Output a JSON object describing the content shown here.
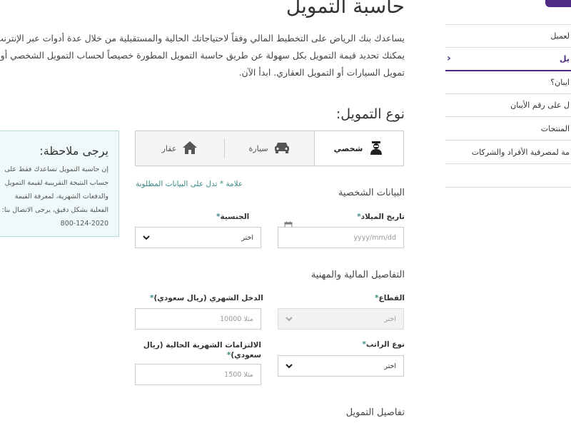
{
  "page": {
    "title": "حاسبة التمويل",
    "intro": "يساعدك بنك الرياض على التخطيط المالي وفقاً لاحتياجاتك الحالية والمستقبلية من خلال عدة أدوات عبر الإنترنت. يمكنك تحديد قيمة التمويل بكل سهولة عن طريق حاسبة التمويل المطورة خصيصاً لحساب التمويل الشخصي أو تمويل السيارات أو التمويل العقاري. ابدأ الآن."
  },
  "sidebar": {
    "items": [
      {
        "label": "لعميل"
      },
      {
        "label": "يل"
      },
      {
        "label": "ايبان؟"
      },
      {
        "label": "ل على رقم الأيبان"
      },
      {
        "label": "المنتجات"
      },
      {
        "label": "مة لمصرفية الأفراد والشركات"
      }
    ],
    "accent": "#4c2a85"
  },
  "financing": {
    "heading": "نوع التمويل:",
    "tabs": [
      {
        "label": "شخصي",
        "icon": "person-icon",
        "selected": true
      },
      {
        "label": "سيارة",
        "icon": "car-icon",
        "selected": false
      },
      {
        "label": "عقار",
        "icon": "home-icon",
        "selected": false
      }
    ],
    "required_note": "علامة * تدل على البيانات المطلوبة"
  },
  "note": {
    "title": "يرجى ملاحظة:",
    "body": "إن حاسبة التمويل تساعدك فقط على حساب النتيجة التقريبية لقيمة التمويل والدفعات الشهرية، لمعرفة القيمة الفعلية بشكل دقيق، يرجى الاتصال بنا: 2020-124-800"
  },
  "personal": {
    "heading": "البيانات الشخصية",
    "birth_label": "تاريخ الميلاد",
    "birth_placeholder": "yyyy/mm/dd",
    "nationality_label": "الجنسية",
    "nationality_value": "اختر"
  },
  "financial": {
    "heading": "التفاصيل المالية والمهنية",
    "sector_label": "القطاع",
    "sector_value": "اختر",
    "income_label": "الدخل الشهري (ريال سعودي)",
    "income_placeholder": "مثلا 10000",
    "salary_type_label": "نوع الراتب",
    "salary_type_value": "اختر",
    "obligations_label": "الالتزامات الشهرية الحالية (ريال سعودي)",
    "obligations_placeholder": "مثلا 1500"
  },
  "financing_details": {
    "heading": "تفاصيل التمويل"
  },
  "required_star": "*"
}
